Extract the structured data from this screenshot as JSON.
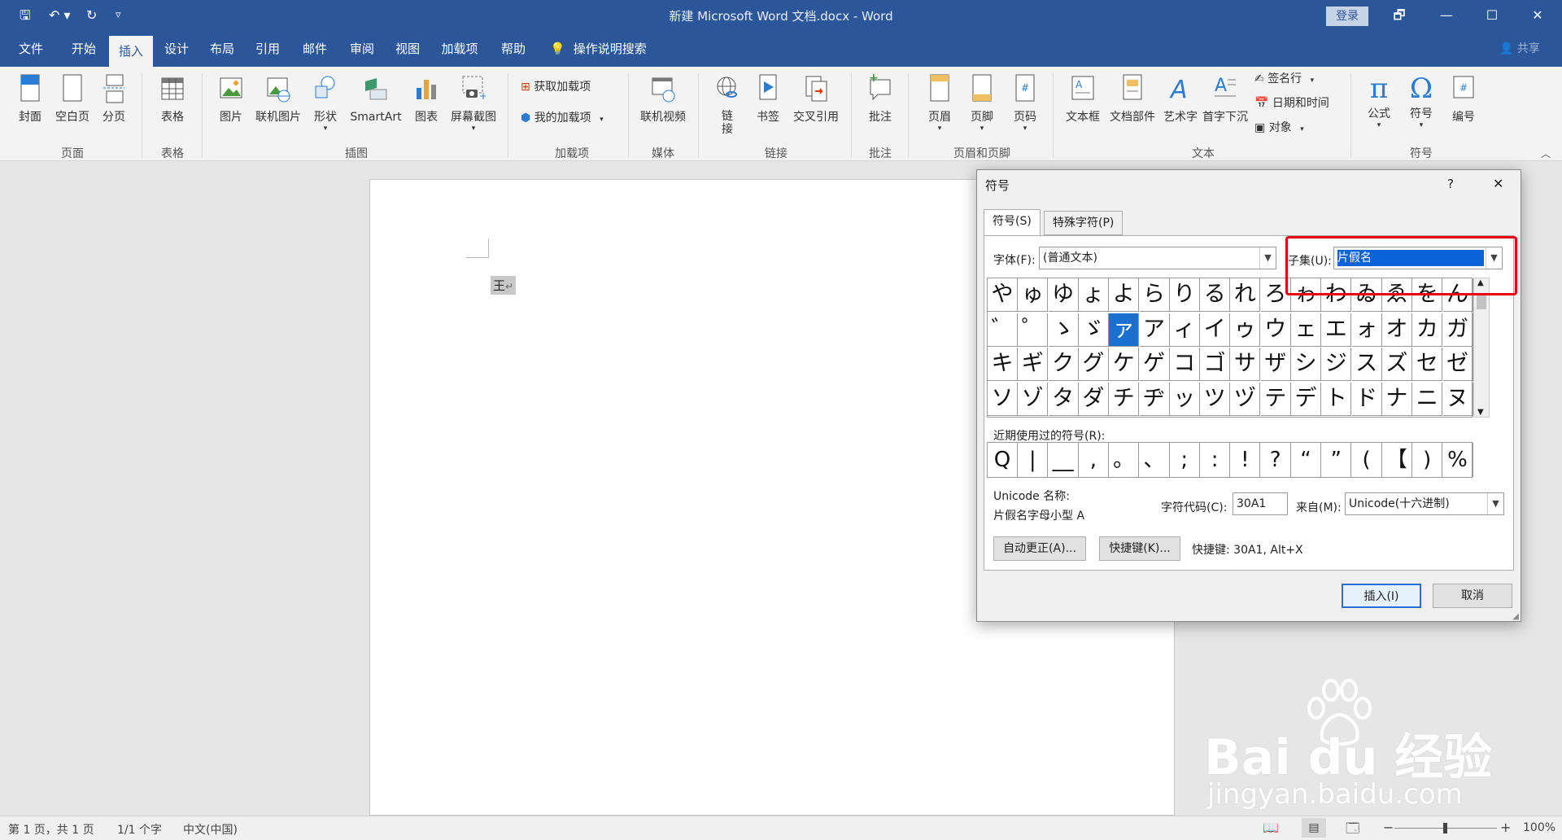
{
  "titlebar": {
    "title": "新建 Microsoft Word 文档.docx  -  Word",
    "login_label": "登录",
    "qat": [
      {
        "icon": "save-icon",
        "glyph": "🖫"
      },
      {
        "icon": "undo-icon",
        "glyph": "↶ ▾"
      },
      {
        "icon": "redo-icon",
        "glyph": "↻"
      },
      {
        "icon": "customize-icon",
        "glyph": "▿"
      }
    ],
    "controls": [
      "🗗",
      "—",
      "☐",
      "✕"
    ]
  },
  "tabs": [
    "文件",
    "开始",
    "插入",
    "设计",
    "布局",
    "引用",
    "邮件",
    "审阅",
    "视图",
    "加载项",
    "帮助"
  ],
  "tellme": "操作说明搜索",
  "share": "共享",
  "ribbon": {
    "groups": [
      "页面",
      "表格",
      "插图",
      "加载项",
      "媒体",
      "链接",
      "批注",
      "页眉和页脚",
      "文本",
      "符号"
    ],
    "page": [
      "封面",
      "空白页",
      "分页"
    ],
    "table": [
      "表格"
    ],
    "illustrations": [
      "图片",
      "联机图片",
      "形状",
      "SmartArt",
      "图表",
      "屏幕截图"
    ],
    "addins": [
      "获取加载项",
      "我的加载项"
    ],
    "media": [
      "联机视频"
    ],
    "links": [
      "链接",
      "书签",
      "交叉引用"
    ],
    "comments": [
      "批注"
    ],
    "headerfooter": [
      "页眉",
      "页脚",
      "页码"
    ],
    "text": [
      "文本框",
      "文档部件",
      "艺术字",
      "首字下沉"
    ],
    "text_small": [
      "签名行",
      "日期和时间",
      "对象"
    ],
    "symbols": [
      "公式",
      "符号",
      "编号"
    ]
  },
  "document": {
    "text": "王",
    "paragraph_mark": "↵"
  },
  "statusbar": {
    "page": "第 1 页，共 1 页",
    "words": "1/1 个字",
    "language": "中文(中国)",
    "zoom": "100%",
    "zoom_minus": "−",
    "zoom_plus": "+"
  },
  "dialog": {
    "title": "符号",
    "help": "?",
    "close": "✕",
    "tab_symbols": "符号(S)",
    "tab_special": "特殊字符(P)",
    "font_label": "字体(F):",
    "font_value": "(普通文本)",
    "subset_label": "子集(U):",
    "subset_value": "片假名",
    "symbols": [
      [
        "や",
        "ゅ",
        "ゆ",
        "ょ",
        "よ",
        "ら",
        "り",
        "る",
        "れ",
        "ろ",
        "ゎ",
        "わ",
        "ゐ",
        "ゑ",
        "を",
        "ん"
      ],
      [
        "゛",
        "゜",
        "ゝ",
        "ゞ",
        "ァ",
        "ア",
        "ィ",
        "イ",
        "ゥ",
        "ウ",
        "ェ",
        "エ",
        "ォ",
        "オ",
        "カ",
        "ガ"
      ],
      [
        "キ",
        "ギ",
        "ク",
        "グ",
        "ケ",
        "ゲ",
        "コ",
        "ゴ",
        "サ",
        "ザ",
        "シ",
        "ジ",
        "ス",
        "ズ",
        "セ",
        "ゼ"
      ],
      [
        "ソ",
        "ゾ",
        "タ",
        "ダ",
        "チ",
        "ヂ",
        "ッ",
        "ツ",
        "ヅ",
        "テ",
        "デ",
        "ト",
        "ド",
        "ナ",
        "ニ",
        "ヌ"
      ]
    ],
    "selected": "ァ",
    "recent_label": "近期使用过的符号(R):",
    "recent": [
      "Q",
      "|",
      "__",
      ",",
      "。",
      "、",
      ";",
      ":",
      "!",
      "?",
      "“",
      "”",
      "(",
      "【",
      ")",
      "%"
    ],
    "unicode_name_label": "Unicode 名称:",
    "unicode_name": "片假名字母小型 A",
    "charcode_label": "字符代码(C):",
    "charcode_value": "30A1",
    "from_label": "来自(M):",
    "from_value": "Unicode(十六进制)",
    "autocorrect_btn": "自动更正(A)...",
    "shortcut_btn": "快捷键(K)...",
    "shortcut_text": "快捷键: 30A1, Alt+X",
    "insert_btn": "插入(I)",
    "cancel_btn": "取消"
  },
  "watermark": {
    "brand": "Bai du 经验",
    "url": "jingyan.baidu.com"
  },
  "colors": {
    "accent": "#2b579a",
    "selection": "#1a6fd1",
    "highlight": "#e60012"
  }
}
